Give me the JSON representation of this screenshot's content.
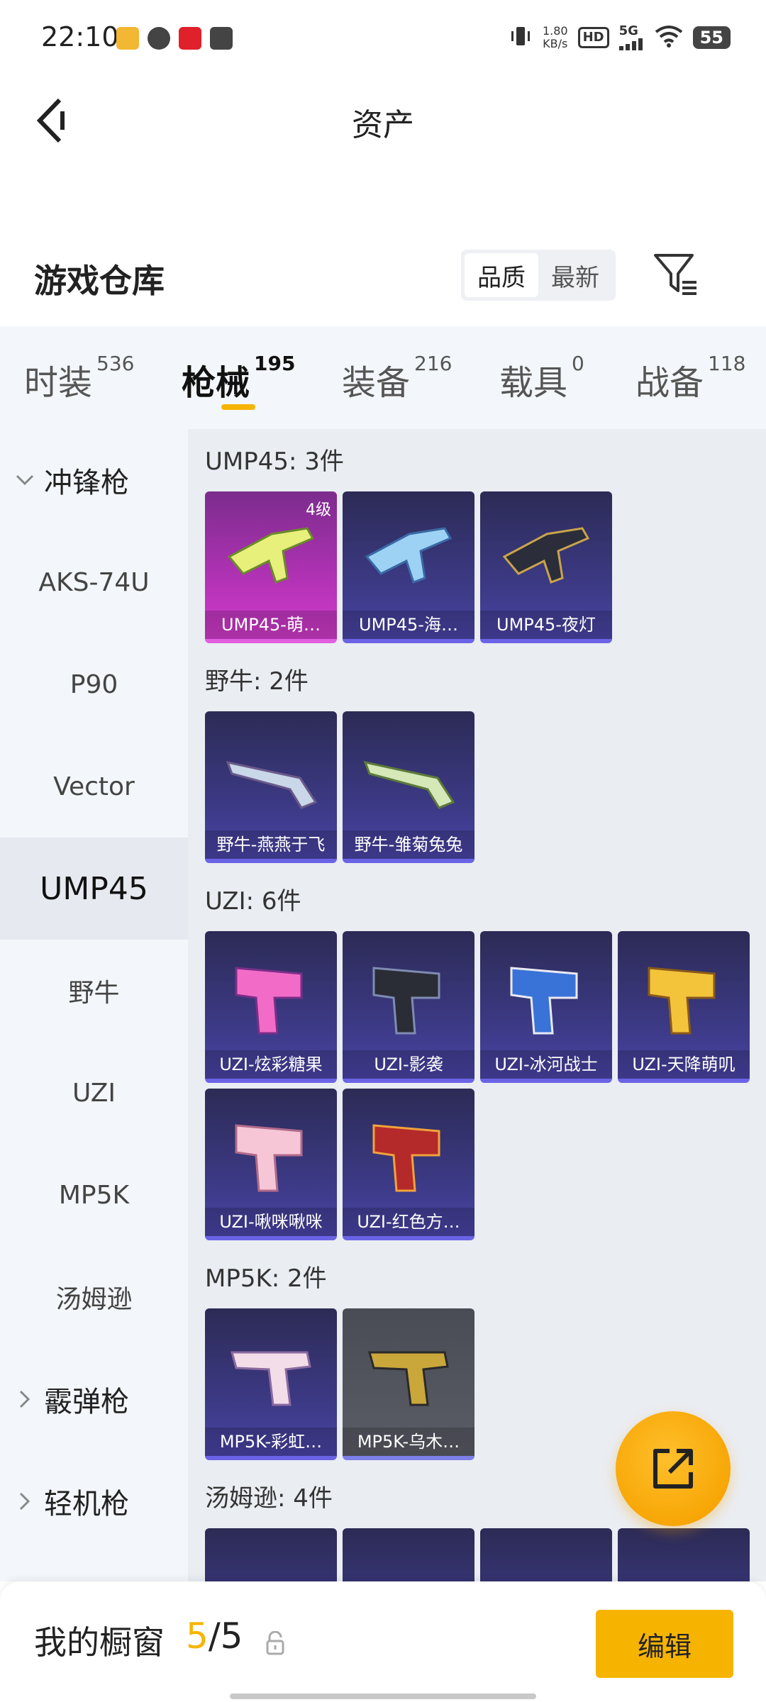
{
  "status_bar": {
    "time": "22:10",
    "net_speed_value": "1.80",
    "net_speed_unit": "KB/s",
    "hd": "HD",
    "network": "5G",
    "battery": "55"
  },
  "header": {
    "title": "资产"
  },
  "section": {
    "title": "游戏仓库",
    "sort_options": [
      "品质",
      "最新"
    ],
    "active_sort": "品质"
  },
  "tabs": [
    {
      "label": "时装",
      "count": "536"
    },
    {
      "label": "枪械",
      "count": "195"
    },
    {
      "label": "装备",
      "count": "216"
    },
    {
      "label": "载具",
      "count": "0"
    },
    {
      "label": "战备",
      "count": "118"
    }
  ],
  "sidebar": {
    "items": [
      {
        "label": "冲锋枪",
        "type": "group",
        "state": "expanded"
      },
      {
        "label": "AKS-74U",
        "type": "item"
      },
      {
        "label": "P90",
        "type": "item"
      },
      {
        "label": "Vector",
        "type": "item"
      },
      {
        "label": "UMP45",
        "type": "item",
        "selected": true
      },
      {
        "label": "野牛",
        "type": "item"
      },
      {
        "label": "UZI",
        "type": "item"
      },
      {
        "label": "MP5K",
        "type": "item"
      },
      {
        "label": "汤姆逊",
        "type": "item"
      },
      {
        "label": "霰弹枪",
        "type": "group",
        "state": "collapsed"
      },
      {
        "label": "轻机枪",
        "type": "group",
        "state": "collapsed"
      }
    ]
  },
  "groups": [
    {
      "title": "UMP45: 3件",
      "items": [
        {
          "name": "UMP45-萌…",
          "level": "4级",
          "rarity": "pink"
        },
        {
          "name": "UMP45-海…",
          "rarity": "purple"
        },
        {
          "name": "UMP45-夜灯",
          "rarity": "purple"
        }
      ]
    },
    {
      "title": "野牛: 2件",
      "items": [
        {
          "name": "野牛-燕燕于飞",
          "rarity": "purple"
        },
        {
          "name": "野牛-雏菊兔兔",
          "rarity": "purple"
        }
      ]
    },
    {
      "title": "UZI: 6件",
      "items": [
        {
          "name": "UZI-炫彩糖果",
          "rarity": "purple"
        },
        {
          "name": "UZI-影袭",
          "rarity": "purple"
        },
        {
          "name": "UZI-冰河战士",
          "rarity": "purple"
        },
        {
          "name": "UZI-天降萌叽",
          "rarity": "purple"
        },
        {
          "name": "UZI-啾咪啾咪",
          "rarity": "purple"
        },
        {
          "name": "UZI-红色方…",
          "rarity": "purple"
        }
      ]
    },
    {
      "title": "MP5K: 2件",
      "items": [
        {
          "name": "MP5K-彩虹…",
          "rarity": "purple"
        },
        {
          "name": "MP5K-乌木…",
          "rarity": "grey"
        }
      ]
    },
    {
      "title": "汤姆逊: 4件",
      "items": [
        {
          "name": "",
          "rarity": "purple"
        },
        {
          "name": "",
          "rarity": "purple"
        },
        {
          "name": "",
          "rarity": "purple"
        },
        {
          "name": "",
          "rarity": "purple"
        }
      ]
    }
  ],
  "bottom": {
    "label": "我的橱窗",
    "current": "5",
    "total": "/5",
    "edit": "编辑"
  },
  "colors": {
    "accent": "#f6b400",
    "card_purple": "#3e3b8a",
    "card_pink": "#b232b5"
  }
}
